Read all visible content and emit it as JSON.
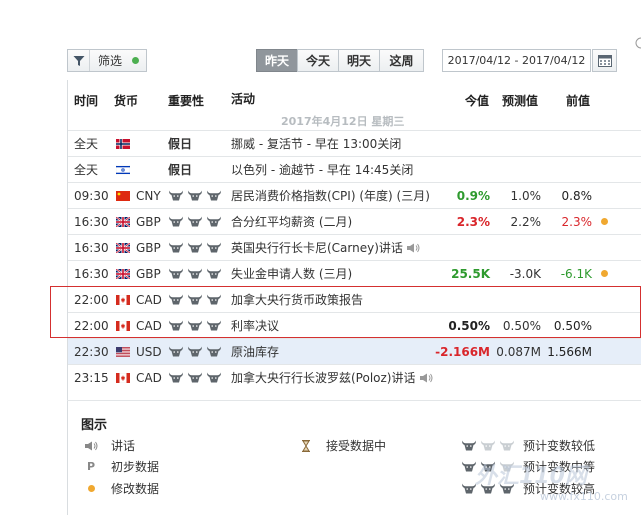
{
  "toolbar": {
    "filter_label": "筛选",
    "day_tabs": [
      "昨天",
      "今天",
      "明天",
      "这周"
    ],
    "active_tab": 0,
    "date_range": "2017/04/12 - 2017/04/12"
  },
  "table": {
    "columns": {
      "time": "时间",
      "currency": "货币",
      "importance": "重要性",
      "event": "活动",
      "actual": "今值",
      "forecast": "预测值",
      "previous": "前值"
    },
    "date_label": "2017年4月12日 星期三",
    "rows": [
      {
        "time": "全天",
        "flag": "norway",
        "currency": "",
        "importance": 0,
        "holiday": "假日",
        "event": "挪威 - 复活节 - 早在 13:00关闭",
        "actual": "",
        "actual_color": "",
        "forecast": "",
        "previous": "",
        "previous_color": "",
        "revised": false,
        "speech": false
      },
      {
        "time": "全天",
        "flag": "israel",
        "currency": "",
        "importance": 0,
        "holiday": "假日",
        "event": "以色列 - 逾越节 - 早在 14:45关闭",
        "actual": "",
        "actual_color": "",
        "forecast": "",
        "previous": "",
        "previous_color": "",
        "revised": false,
        "speech": false
      },
      {
        "time": "09:30",
        "flag": "china",
        "currency": "CNY",
        "importance": 3,
        "holiday": "",
        "event": "居民消费价格指数(CPI) (年度) (三月)",
        "actual": "0.9%",
        "actual_color": "green",
        "forecast": "1.0%",
        "previous": "0.8%",
        "previous_color": "dark",
        "revised": false,
        "speech": false
      },
      {
        "time": "16:30",
        "flag": "uk",
        "currency": "GBP",
        "importance": 3,
        "holiday": "",
        "event": "合分红平均薪资 (二月)",
        "actual": "2.3%",
        "actual_color": "red",
        "forecast": "2.2%",
        "previous": "2.3%",
        "previous_color": "red",
        "revised": true,
        "speech": false
      },
      {
        "time": "16:30",
        "flag": "uk",
        "currency": "GBP",
        "importance": 3,
        "holiday": "",
        "event": "英国央行行长卡尼(Carney)讲话",
        "actual": "",
        "actual_color": "",
        "forecast": "",
        "previous": "",
        "previous_color": "",
        "revised": false,
        "speech": true
      },
      {
        "time": "16:30",
        "flag": "uk",
        "currency": "GBP",
        "importance": 3,
        "holiday": "",
        "event": "失业金申请人数 (三月)",
        "actual": "25.5K",
        "actual_color": "green",
        "forecast": "-3.0K",
        "previous": "-6.1K",
        "previous_color": "green",
        "revised": true,
        "speech": false
      },
      {
        "time": "22:00",
        "flag": "canada",
        "currency": "CAD",
        "importance": 3,
        "holiday": "",
        "event": "加拿大央行货币政策报告",
        "actual": "",
        "actual_color": "",
        "forecast": "",
        "previous": "",
        "previous_color": "",
        "revised": false,
        "speech": false
      },
      {
        "time": "22:00",
        "flag": "canada",
        "currency": "CAD",
        "importance": 3,
        "holiday": "",
        "event": "利率决议",
        "actual": "0.50%",
        "actual_color": "dark",
        "forecast": "0.50%",
        "previous": "0.50%",
        "previous_color": "dark",
        "revised": false,
        "speech": false
      },
      {
        "time": "22:30",
        "flag": "usa",
        "currency": "USD",
        "importance": 3,
        "holiday": "",
        "event": "原油库存",
        "actual": "-2.166M",
        "actual_color": "red",
        "forecast": "0.087M",
        "previous": "1.566M",
        "previous_color": "dark",
        "revised": false,
        "speech": false,
        "highlight": true
      },
      {
        "time": "23:15",
        "flag": "canada",
        "currency": "CAD",
        "importance": 3,
        "holiday": "",
        "event": "加拿大央行行长波罗兹(Poloz)讲话",
        "actual": "",
        "actual_color": "",
        "forecast": "",
        "previous": "",
        "previous_color": "",
        "revised": false,
        "speech": true
      }
    ]
  },
  "legend": {
    "title": "图示",
    "speech": "讲话",
    "preliminary": "初步数据",
    "preliminary_glyph": "P",
    "revised": "修改数据",
    "receiving": "接受数据中",
    "low": "预计变数较低",
    "medium": "预计变数中等",
    "high": "预计变数较高"
  },
  "watermark": {
    "brand": "外汇110网",
    "url": "www.fx110.com"
  },
  "colors": {
    "positive": "#2e9a2e",
    "negative": "#d9262b",
    "highlight_row": "#e6eef9",
    "outline": "#d43030"
  }
}
